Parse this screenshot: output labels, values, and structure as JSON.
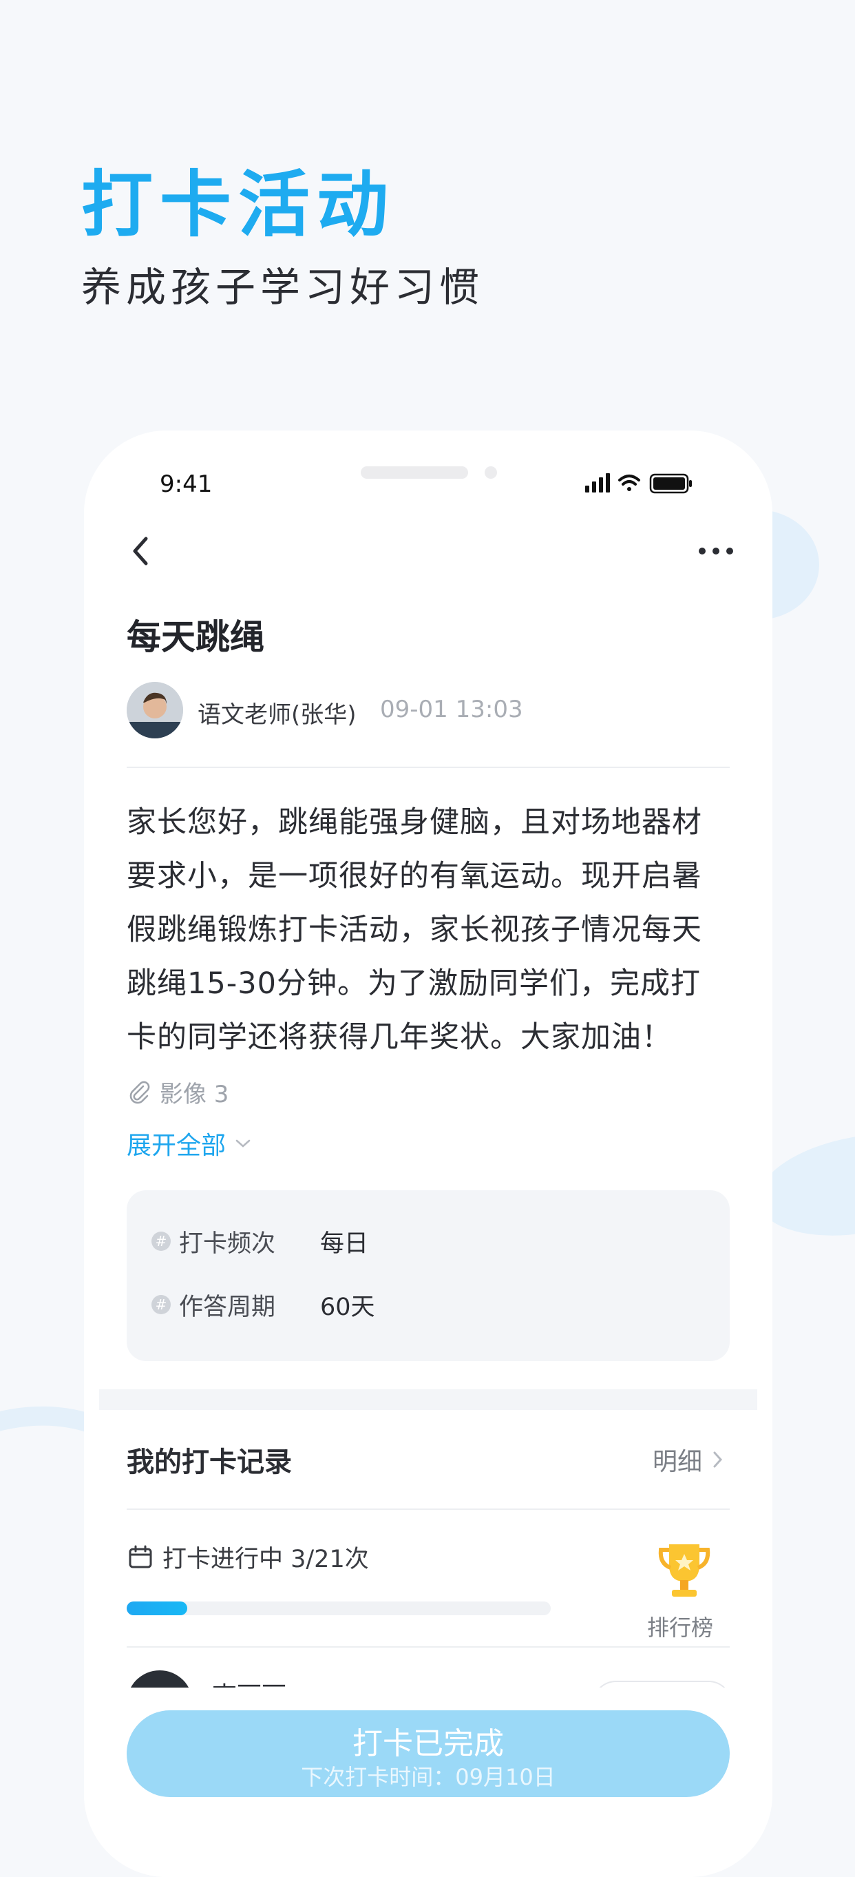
{
  "hero": {
    "title": "打卡活动",
    "subtitle": "养成孩子学习好习惯"
  },
  "status_bar": {
    "time": "9:41",
    "icons": [
      "signal-icon",
      "wifi-icon",
      "battery-icon"
    ]
  },
  "nav": {
    "back_icon": "chevron-left-icon",
    "more_icon": "more-horizontal-icon"
  },
  "post": {
    "title": "每天跳绳",
    "author": "语文老师(张华)",
    "time": "09-01 13:03",
    "body_lines": [
      "家长您好，跳绳能强身健脑，且对场地器材",
      "要求小，是一项很好的有氧运动。现开启暑",
      "假跳绳锻炼打卡活动，家长视孩子情况每天",
      "跳绳15-30分钟。为了激励同学们，完成打",
      "卡的同学还将获得几年奖状。大家加油！"
    ],
    "attachment": "影像 3",
    "expand_label": "展开全部"
  },
  "info": {
    "frequency_label": "打卡频次",
    "frequency_value": "每日",
    "period_label": "作答周期",
    "period_value": "60天",
    "hash_symbol": "#"
  },
  "records": {
    "title": "我的打卡记录",
    "detail_label": "明细",
    "progress_text": "打卡进行中 3/21次",
    "progress_done": 3,
    "progress_total": 21,
    "rank_label": "排行榜",
    "next_user_name": "李丽丽"
  },
  "cta": {
    "main": "打卡已完成",
    "sub": "下次打卡时间：09月10日"
  },
  "colors": {
    "accent": "#1eabf0",
    "cta_bg": "#9bd9f7",
    "progress": "#1ea8f2"
  }
}
